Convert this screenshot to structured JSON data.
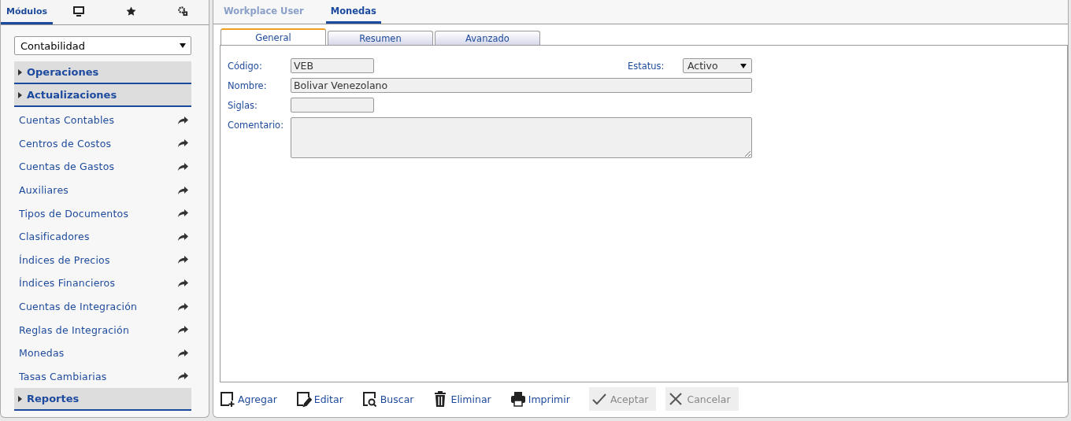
{
  "left_tabs": [
    {
      "kind": "text",
      "label": "Módulos",
      "selected": true
    },
    {
      "kind": "monitor",
      "selected": false
    },
    {
      "kind": "star",
      "selected": false
    },
    {
      "kind": "gears",
      "selected": false
    }
  ],
  "module_select": {
    "value": "Contabilidad"
  },
  "menu": [
    {
      "kind": "section",
      "label": "Operaciones"
    },
    {
      "kind": "section",
      "label": "Actualizaciones"
    },
    {
      "kind": "item",
      "label": "Cuentas Contables"
    },
    {
      "kind": "item",
      "label": "Centros de Costos"
    },
    {
      "kind": "item",
      "label": "Cuentas de Gastos"
    },
    {
      "kind": "item",
      "label": "Auxiliares"
    },
    {
      "kind": "item",
      "label": "Tipos de Documentos"
    },
    {
      "kind": "item",
      "label": "Clasificadores"
    },
    {
      "kind": "item",
      "label": "Índices de Precios"
    },
    {
      "kind": "item",
      "label": "Índices Financieros"
    },
    {
      "kind": "item",
      "label": "Cuentas de Integración"
    },
    {
      "kind": "item",
      "label": "Reglas de Integración"
    },
    {
      "kind": "item",
      "label": "Monedas"
    },
    {
      "kind": "item",
      "label": "Tasas Cambiarias"
    },
    {
      "kind": "section",
      "label": "Reportes"
    }
  ],
  "top_tabs": [
    {
      "label": "Workplace User",
      "selected": false
    },
    {
      "label": "Monedas",
      "selected": true
    }
  ],
  "sub_tabs": [
    {
      "label": "General",
      "selected": true
    },
    {
      "label": "Resumen",
      "selected": false
    },
    {
      "label": "Avanzado",
      "selected": false
    }
  ],
  "form": {
    "rows": [
      [
        {
          "kind": "short",
          "label": "Código:",
          "value": "VEB"
        },
        {
          "kind": "select",
          "label": "Estatus:",
          "value": "Activo"
        }
      ],
      [
        {
          "kind": "long",
          "label": "Nombre:",
          "value": "Bolivar Venezolano"
        }
      ],
      [
        {
          "kind": "short",
          "label": "Siglas:"
        }
      ],
      [
        {
          "kind": "textarea",
          "label": "Comentario:"
        }
      ]
    ]
  },
  "toolbar": [
    {
      "kind": "add",
      "label": "Agregar",
      "disabled": false
    },
    {
      "kind": "edit",
      "label": "Editar",
      "disabled": false
    },
    {
      "kind": "search",
      "label": "Buscar",
      "disabled": false
    },
    {
      "kind": "trash",
      "label": "Eliminar",
      "disabled": false
    },
    {
      "kind": "print",
      "label": "Imprimir",
      "disabled": false
    },
    {
      "kind": "check",
      "label": "Aceptar",
      "disabled": true
    },
    {
      "kind": "close",
      "label": "Cancelar",
      "disabled": true
    }
  ]
}
